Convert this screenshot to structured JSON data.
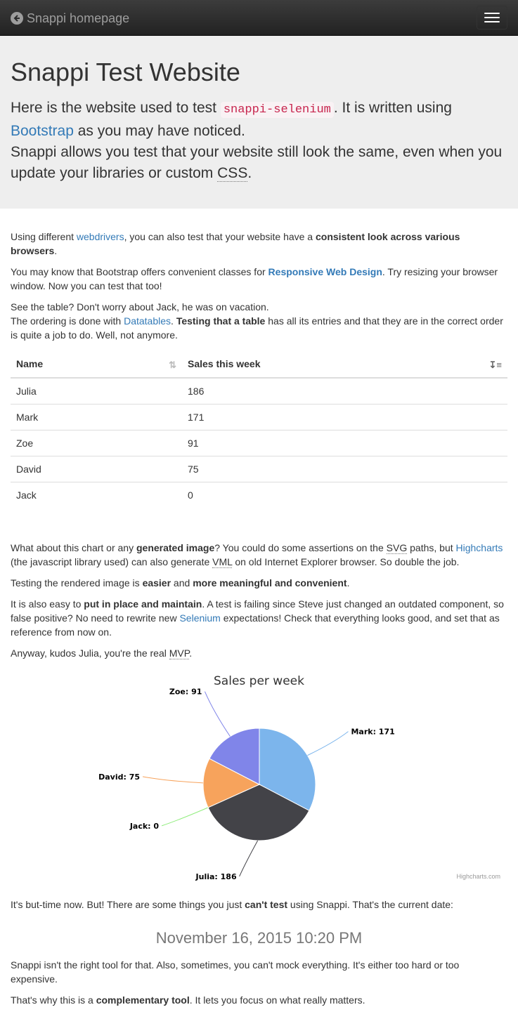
{
  "navbar": {
    "brand": "Snappi homepage",
    "back_icon": "arrow-left-circle-icon",
    "menu_icon": "hamburger-icon"
  },
  "jumbotron": {
    "title": "Snappi Test Website",
    "p1_a": "Here is the website used to test ",
    "p1_code": "snappi-selenium",
    "p1_b": ". It is written using ",
    "p1_link": "Bootstrap",
    "p1_c": " as you may have noticed.",
    "p2_a": "Snappi allows you test that your website still look the same, even when you update your libraries or custom ",
    "p2_abbr": "CSS",
    "p2_b": "."
  },
  "intro": {
    "s1_a": "Using different ",
    "s1_link": "webdrivers",
    "s1_b": ", you can also test that your website have a ",
    "s1_bold": "consistent look across various browsers",
    "s1_c": ".",
    "s2_a": "You may know that Bootstrap offers convenient classes for ",
    "s2_link": "Responsive Web Design",
    "s2_b": ". Try resizing your browser window. Now you can test that too!",
    "s3_line1": "See the table? Don't worry about Jack, he was on vacation.",
    "s3_a": "The ordering is done with ",
    "s3_link": "Datatables",
    "s3_b": ". ",
    "s3_bold": "Testing that a table",
    "s3_c": " has all its entries and that they are in the correct order is quite a job to do. Well, not anymore."
  },
  "table": {
    "headers": [
      "Name",
      "Sales this week"
    ],
    "rows": [
      [
        "Julia",
        "186"
      ],
      [
        "Mark",
        "171"
      ],
      [
        "Zoe",
        "91"
      ],
      [
        "David",
        "75"
      ],
      [
        "Jack",
        "0"
      ]
    ]
  },
  "chart_section": {
    "c1_a": "What about this chart or any ",
    "c1_bold": "generated image",
    "c1_b": "? You could do some assertions on the ",
    "c1_abbr1": "SVG",
    "c1_c": " paths, but ",
    "c1_link": "Highcharts",
    "c1_d": " (the javascript library used) can also generate ",
    "c1_abbr2": "VML",
    "c1_e": " on old Internet Explorer browser. So double the job.",
    "c2_a": "Testing the rendered image is ",
    "c2_bold1": "easier",
    "c2_b": " and ",
    "c2_bold2": "more meaningful and convenient",
    "c2_c": ".",
    "c3_a": "It is also easy to ",
    "c3_bold": "put in place and maintain",
    "c3_b": ". A test is failing since Steve just changed an outdated component, so false positive? No need to rewrite new ",
    "c3_link": "Selenium",
    "c3_c": " expectations! Check that everything looks good, and set that as reference from now on.",
    "c4_a": "Anyway, kudos Julia, you're the real ",
    "c4_abbr": "MVP",
    "c4_b": "."
  },
  "chart_data": {
    "type": "pie",
    "title": "Sales per week",
    "slices": [
      {
        "name": "Mark",
        "value": 171,
        "color": "#7cb5ec",
        "label": "Mark: 171"
      },
      {
        "name": "Julia",
        "value": 186,
        "color": "#434348",
        "label": "Julia: 186"
      },
      {
        "name": "Jack",
        "value": 0,
        "color": "#90ed7d",
        "label": "Jack: 0"
      },
      {
        "name": "David",
        "value": 75,
        "color": "#f7a35c",
        "label": "David: 75"
      },
      {
        "name": "Zoe",
        "value": 91,
        "color": "#8085e9",
        "label": "Zoe: 91"
      }
    ],
    "credits": "Highcharts.com"
  },
  "footer": {
    "f1_a": "It's but-time now. But! There are some things you just ",
    "f1_bold": "can't test",
    "f1_b": " using Snappi. That's the current date:",
    "date": "November 16, 2015 10:20 PM",
    "f2": "Snappi isn't the right tool for that. Also, sometimes, you can't mock everything. It's either too hard or too expensive.",
    "f3_a": "That's why this is a ",
    "f3_bold": "complementary tool",
    "f3_b": ". It lets you focus on what really matters."
  }
}
